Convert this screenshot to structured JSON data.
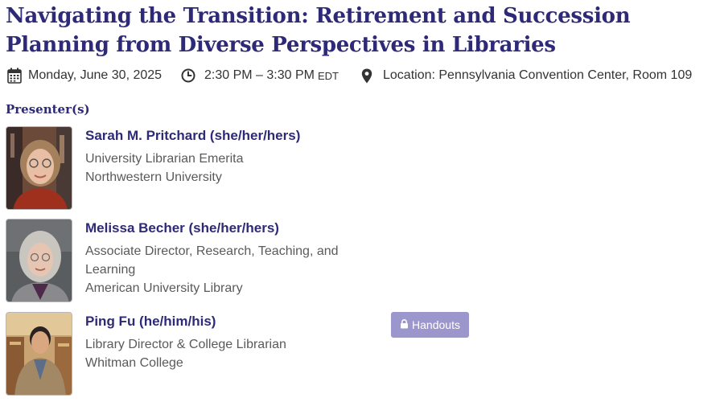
{
  "session": {
    "title": "Navigating the Transition: Retirement and Succession Planning from Diverse Perspectives in Libraries",
    "date": "Monday, June 30, 2025",
    "time": "2:30 PM – 3:30 PM",
    "timezone": "EDT",
    "location": "Location: Pennsylvania Convention Center, Room 109"
  },
  "icons": {
    "date": "calendar-icon",
    "time": "clock-icon",
    "location": "map-pin-icon",
    "handouts": "lock-icon"
  },
  "presenters_heading": "Presenter(s)",
  "presenters": [
    {
      "name": "Sarah M. Pritchard (she/her/hers)",
      "lines": [
        "University Librarian Emerita",
        "Northwestern University"
      ]
    },
    {
      "name": "Melissa Becher (she/her/hers)",
      "lines": [
        "Associate Director, Research, Teaching, and",
        "Learning",
        "American University Library"
      ]
    },
    {
      "name": "Ping Fu (he/him/his)",
      "lines": [
        "Library Director & College Librarian",
        "Whitman College"
      ]
    }
  ],
  "handouts_label": "Handouts",
  "colors": {
    "heading": "#2e2a78",
    "button": "#9b96cc"
  }
}
